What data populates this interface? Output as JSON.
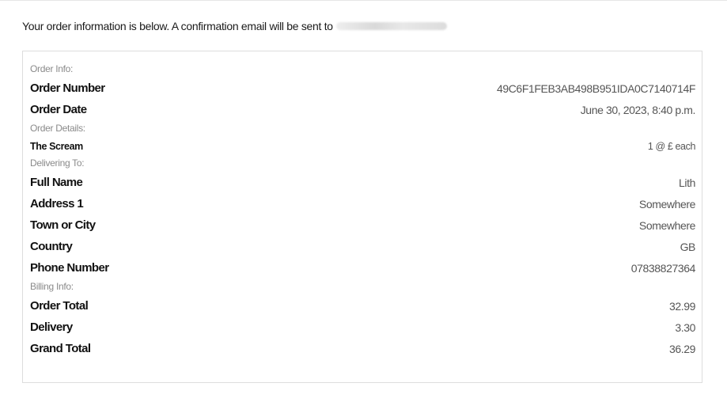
{
  "intro": {
    "text": "Your order information is below. A confirmation email will be sent to"
  },
  "order_info": {
    "heading": "Order Info:",
    "order_number_label": "Order Number",
    "order_number_value": "49C6F1FEB3AB498B951IDA0C7140714F",
    "order_date_label": "Order Date",
    "order_date_value": "June 30, 2023, 8:40 p.m."
  },
  "order_details": {
    "heading": "Order Details:",
    "item_name": "The Scream",
    "item_qty": "1 @ £ each"
  },
  "delivering_to": {
    "heading": "Delivering To:",
    "full_name_label": "Full Name",
    "full_name_value": "Lith",
    "address1_label": "Address 1",
    "address1_value": "Somewhere",
    "town_label": "Town or City",
    "town_value": "Somewhere",
    "country_label": "Country",
    "country_value": "GB",
    "phone_label": "Phone Number",
    "phone_value": "07838827364"
  },
  "billing_info": {
    "heading": "Billing Info:",
    "order_total_label": "Order Total",
    "order_total_value": "32.99",
    "delivery_label": "Delivery",
    "delivery_value": "3.30",
    "grand_total_label": "Grand Total",
    "grand_total_value": "36.29"
  }
}
